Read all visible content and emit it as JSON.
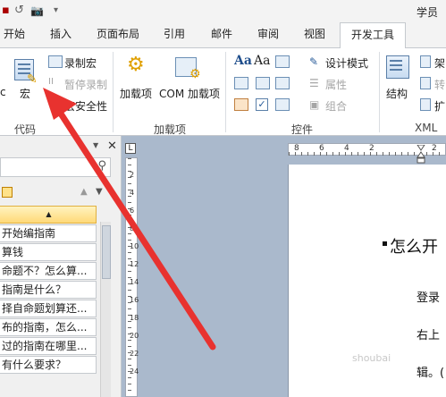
{
  "titlebar": {
    "doc_title": "学员",
    "quick_access": [
      "↺",
      "📷",
      "▾"
    ]
  },
  "tabs": [
    {
      "label": "开始",
      "active": false
    },
    {
      "label": "插入",
      "active": false
    },
    {
      "label": "页面布局",
      "active": false
    },
    {
      "label": "引用",
      "active": false
    },
    {
      "label": "邮件",
      "active": false
    },
    {
      "label": "审阅",
      "active": false
    },
    {
      "label": "视图",
      "active": false
    },
    {
      "label": "开发工具",
      "active": true
    }
  ],
  "ribbon": {
    "code": {
      "label": "代码",
      "vba_partial": "c",
      "macros": "宏",
      "record_macro": "录制宏",
      "pause_recording": "暂停录制",
      "macro_security": "宏安全性"
    },
    "addins": {
      "label": "加载项",
      "addins": "加载项",
      "com_addins": "COM 加载项"
    },
    "controls": {
      "label": "控件",
      "design_mode": "设计模式",
      "properties": "属性",
      "group": "组合"
    },
    "xml": {
      "label": "XML",
      "structure": "结构",
      "partial_1": "架",
      "partial_2": "转",
      "partial_3": "扩"
    },
    "accent": "#1f4e8c"
  },
  "nav_pane": {
    "items": [
      "开始编指南",
      "算钱",
      "命题不？怎么算...",
      "指南是什么？",
      "择自命题划算还...",
      "布的指南，怎么...",
      "过的指南在哪里...",
      "有什么要求？"
    ],
    "head_symbol": "▲"
  },
  "ruler": {
    "h_numbers": [
      "8",
      "6",
      "4",
      "2",
      "2"
    ],
    "v_numbers": [
      "2",
      "4",
      "6",
      "8",
      "10",
      "12",
      "14",
      "16",
      "18",
      "20",
      "22",
      "24"
    ]
  },
  "document": {
    "heading": "怎么开",
    "lines": [
      "登录",
      "右上",
      "辑。("
    ]
  },
  "watermark": "shoubai"
}
